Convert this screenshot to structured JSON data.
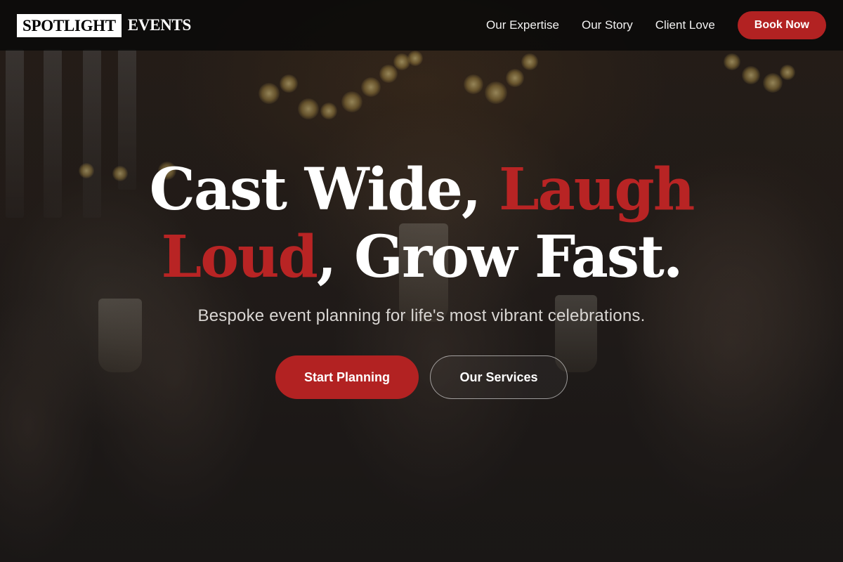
{
  "brand": {
    "logo_box_text": "SPOTLIGHT",
    "logo_rest_text": "EVENTS"
  },
  "nav": {
    "links": [
      {
        "label": "Our Expertise"
      },
      {
        "label": "Our Story"
      },
      {
        "label": "Client Love"
      }
    ],
    "cta_label": "Book Now"
  },
  "hero": {
    "headline_part1": "Cast Wide, ",
    "headline_accent1": "Laugh",
    "headline_accent2": "Loud",
    "headline_part2": ", Grow Fast.",
    "subtitle": "Bespoke event planning for life's most vibrant celebrations.",
    "primary_cta": "Start Planning",
    "secondary_cta": "Our Services"
  },
  "colors": {
    "accent": "#b22222",
    "nav_background": "#080808",
    "text": "#ffffff"
  }
}
